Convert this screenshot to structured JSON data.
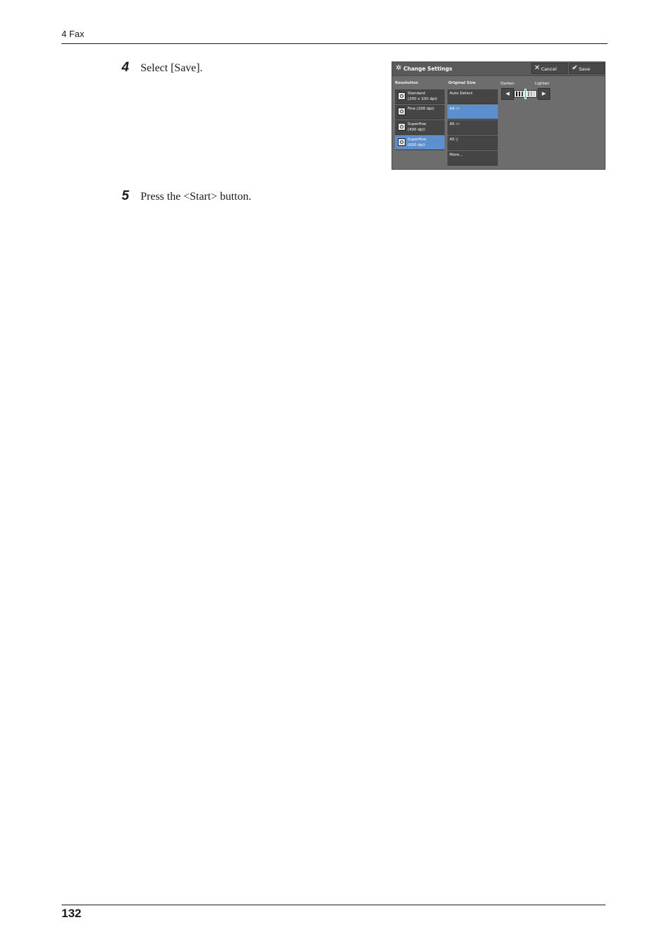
{
  "page": {
    "chapter": "4 Fax",
    "page_number": "132",
    "steps": [
      {
        "num": "4",
        "text": "Select [Save]."
      },
      {
        "num": "5",
        "text": "Press the <Start> button."
      }
    ]
  },
  "screen": {
    "title": "Change Settings",
    "title_icon": "gear-icon",
    "cancel_label": "Cancel",
    "save_label": "Save",
    "resolution": {
      "label": "Resolution",
      "items": [
        {
          "line1": "Standard",
          "line2": "(200 x 100 dpi)",
          "selected": false
        },
        {
          "line1": "Fine (200 dpi)",
          "line2": "",
          "selected": false
        },
        {
          "line1": "Superfine",
          "line2": "(400 dpi)",
          "selected": false
        },
        {
          "line1": "Superfine",
          "line2": "(600 dpi)",
          "selected": true
        }
      ]
    },
    "original_size": {
      "label": "Original Size",
      "items": [
        {
          "label": "Auto Detect",
          "selected": false
        },
        {
          "label": "A4 ▭",
          "selected": true
        },
        {
          "label": "A5 ▭",
          "selected": false
        },
        {
          "label": "A5 ▯",
          "selected": false
        },
        {
          "label": "More...",
          "selected": false
        }
      ]
    },
    "density": {
      "darken_label": "Darken",
      "lighten_label": "Lighten",
      "level_fraction": 0.5
    },
    "colors": {
      "selected": "#5b8fce",
      "panel": "#6d6d6d",
      "button": "#454545"
    }
  }
}
